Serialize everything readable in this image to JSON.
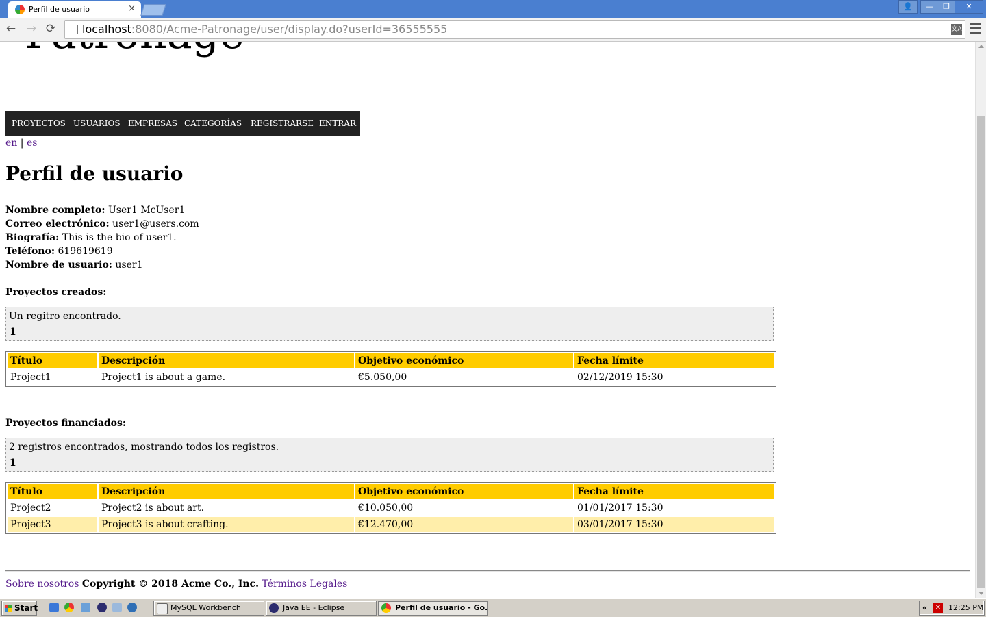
{
  "browser": {
    "tab_title": "Perfil de usuario",
    "tab_close": "×",
    "url_host": "localhost",
    "url_rest": ":8080/Acme-Patronage/user/display.do?userId=36555555",
    "back": "←",
    "forward": "→",
    "reload": "⟳",
    "translate": "文A",
    "window_user": "👤",
    "window_min": "—",
    "window_restore": "❐",
    "window_close": "✕"
  },
  "header": {
    "logo_text": "Patronage"
  },
  "nav": {
    "items": [
      {
        "label": "PROYECTOS"
      },
      {
        "label": "USUARIOS"
      },
      {
        "label": "EMPRESAS"
      },
      {
        "label": "CATEGORÍAS"
      },
      {
        "label": "REGISTRARSE"
      },
      {
        "label": "ENTRAR"
      }
    ]
  },
  "lang": {
    "en": "en",
    "sep": " | ",
    "es": "es"
  },
  "page": {
    "title": "Perfil de usuario"
  },
  "profile": {
    "fullname_label": "Nombre completo:",
    "fullname": " User1 McUser1",
    "email_label": "Correo electrónico:",
    "email": " user1@users.com",
    "bio_label": "Biografía:",
    "bio": " This is the bio of user1.",
    "phone_label": "Teléfono:",
    "phone": " 619619619",
    "username_label": "Nombre de usuario:",
    "username": " user1"
  },
  "created": {
    "label": "Proyectos creados:",
    "banner": "Un regitro encontrado.",
    "page": "1",
    "headers": [
      "Título",
      "Descripción",
      "Objetivo económico",
      "Fecha límite"
    ],
    "rows": [
      [
        "Project1",
        "Project1 is about a game.",
        "€5.050,00",
        "02/12/2019 15:30"
      ]
    ]
  },
  "funded": {
    "label": "Proyectos financiados:",
    "banner": "2 registros encontrados, mostrando todos los registros.",
    "page": "1",
    "headers": [
      "Título",
      "Descripción",
      "Objetivo económico",
      "Fecha límite"
    ],
    "rows": [
      [
        "Project2",
        "Project2 is about art.",
        "€10.050,00",
        "01/01/2017 15:30"
      ],
      [
        "Project3",
        "Project3 is about crafting.",
        "€12.470,00",
        "03/01/2017 15:30"
      ]
    ]
  },
  "footer": {
    "about": "Sobre nosotros",
    "copyright": "Copyright © 2018 Acme Co., Inc.",
    "legal": "Términos Legales"
  },
  "taskbar": {
    "start": "Start",
    "tasks": [
      {
        "label": "MySQL Workbench"
      },
      {
        "label": "Java EE - Eclipse"
      },
      {
        "label": "Perfil de usuario - Go..."
      }
    ],
    "tray_chevron": "«",
    "tray_icon": "✕",
    "clock": "12:25 PM"
  },
  "colors": {
    "nav_bg": "#222222",
    "table_header": "#ffcc00",
    "row_alt": "#ffeeaa",
    "banner_bg": "#eeeeee",
    "link": "#551a8b"
  }
}
